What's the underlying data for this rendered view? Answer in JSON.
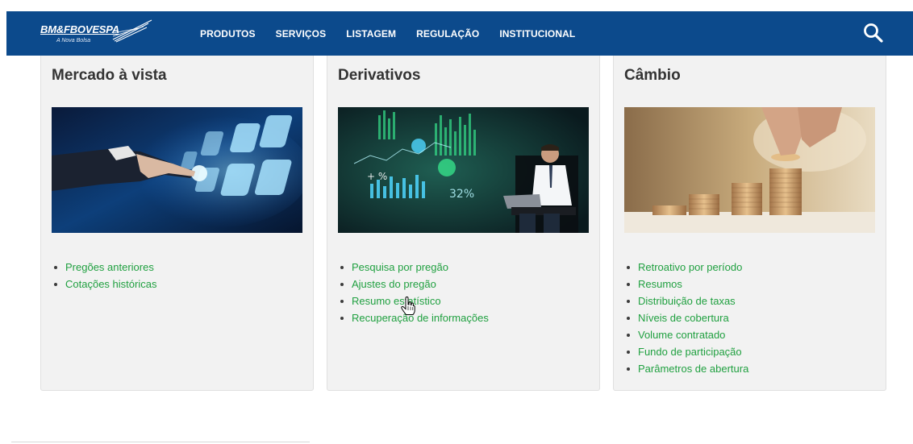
{
  "header": {
    "logo": {
      "text": "BM&FBOVESPA",
      "tagline": "A Nova Bolsa"
    },
    "nav": [
      "PRODUTOS",
      "SERVIÇOS",
      "LISTAGEM",
      "REGULAÇÃO",
      "INSTITUCIONAL"
    ],
    "search_icon": "search-icon"
  },
  "colors": {
    "navbar": "#0c4a8c",
    "link": "#20a040",
    "card_bg": "#f2f2f2"
  },
  "cards": [
    {
      "title": "Mercado à vista",
      "image": "hand-touching-digital-tiles",
      "links": [
        "Pregões anteriores",
        "Cotações históricas"
      ]
    },
    {
      "title": "Derivativos",
      "image": "businessman-with-laptop-and-charts",
      "links": [
        "Pesquisa por pregão",
        "Ajustes do pregão",
        "Resumo estatístico",
        "Recuperação de informações"
      ]
    },
    {
      "title": "Câmbio",
      "image": "hand-stacking-coins",
      "links": [
        "Retroativo por período",
        "Resumos",
        "Distribuição de taxas",
        "Níveis de cobertura",
        "Volume contratado",
        "Fundo de participação",
        "Parâmetros de abertura"
      ]
    }
  ]
}
